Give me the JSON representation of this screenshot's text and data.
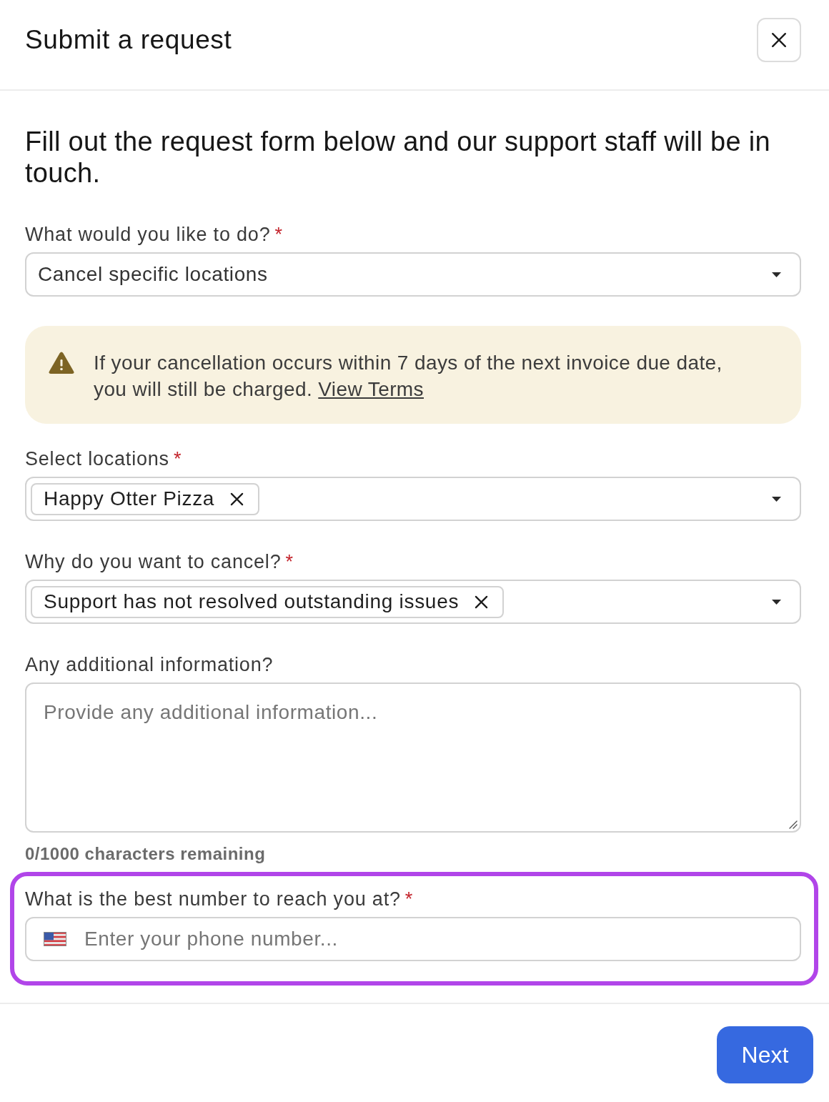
{
  "header": {
    "title": "Submit a request"
  },
  "intro": "Fill out the request form below and our support staff will be in touch.",
  "form": [
    {
      "kind": "select",
      "label": "What would you like to do?",
      "required_mark": "*",
      "value": "Cancel specific locations"
    },
    {
      "kind": "notice",
      "text": "If your cancellation occurs within 7 days of the next invoice due date, you will still be charged.",
      "link": "View Terms"
    },
    {
      "kind": "multiselect",
      "label": "Select locations",
      "required_mark": "*",
      "chips": [
        "Happy Otter Pizza"
      ]
    },
    {
      "kind": "multiselect",
      "label": "Why do you want to cancel?",
      "required_mark": "*",
      "chips": [
        "Support has not resolved outstanding issues"
      ]
    },
    {
      "kind": "textarea",
      "label": "Any additional information?",
      "placeholder": "Provide any additional information...",
      "counter": "0/1000 characters remaining"
    },
    {
      "kind": "phone",
      "label": "What is the best number to reach you at?",
      "required_mark": "*",
      "placeholder": "Enter your phone number...",
      "highlighted": true
    }
  ],
  "footer": {
    "next_button": "Next"
  }
}
